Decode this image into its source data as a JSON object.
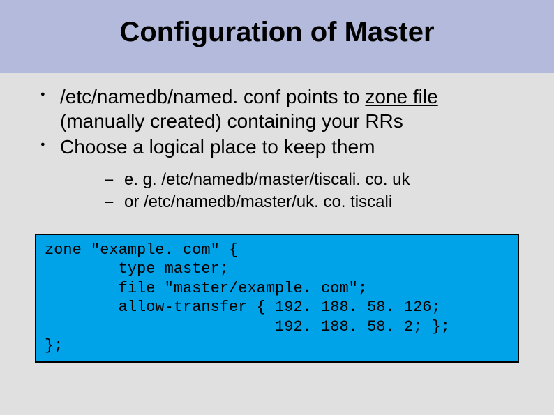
{
  "title": "Configuration of Master",
  "bullets": {
    "b1_part1": "/etc/namedb/named. conf points to ",
    "b1_underline": "zone file",
    "b1_part2": " (manually created) containing your RRs",
    "b2": "Choose a logical place to keep them"
  },
  "subbullets": {
    "s1": "e. g.  /etc/namedb/master/tiscali. co. uk",
    "s2": "or    /etc/namedb/master/uk. co. tiscali"
  },
  "code": "zone \"example. com\" {\n        type master;\n        file \"master/example. com\";\n        allow-transfer { 192. 188. 58. 126;\n                         192. 188. 58. 2; };\n};"
}
